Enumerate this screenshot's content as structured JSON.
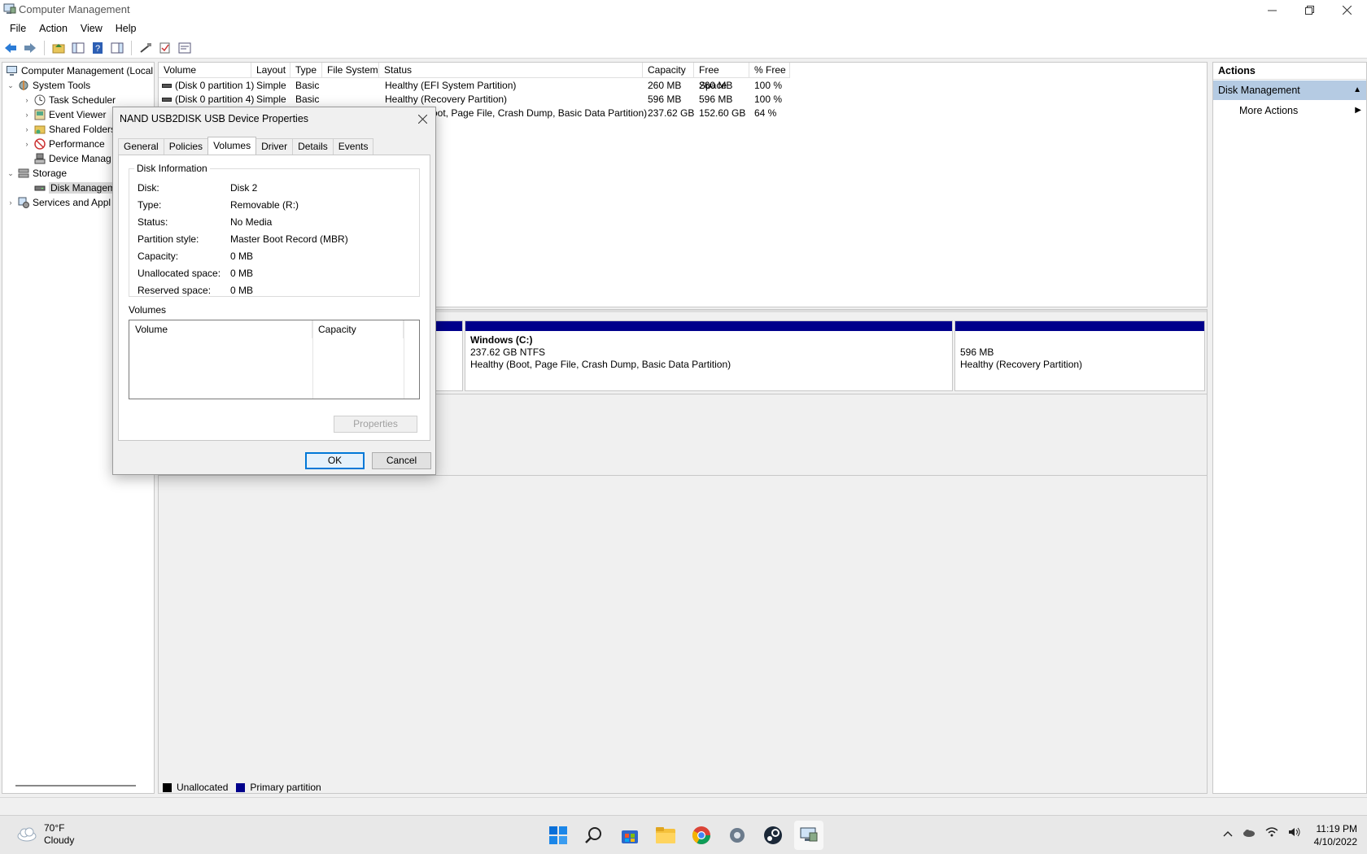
{
  "window": {
    "title": "Computer Management"
  },
  "menu": [
    "File",
    "Action",
    "View",
    "Help"
  ],
  "tree": {
    "root": "Computer Management (Local",
    "items": [
      {
        "label": "System Tools",
        "expander": "⌄"
      },
      {
        "label": "Task Scheduler",
        "expander": "›"
      },
      {
        "label": "Event Viewer",
        "expander": "›"
      },
      {
        "label": "Shared Folders",
        "expander": "›"
      },
      {
        "label": "Performance",
        "expander": "›"
      },
      {
        "label": "Device Manag",
        "expander": ""
      },
      {
        "label": "Storage",
        "expander": "⌄"
      },
      {
        "label": "Disk Managem",
        "expander": ""
      },
      {
        "label": "Services and Appl",
        "expander": "›"
      }
    ]
  },
  "volumes": {
    "columns": [
      "Volume",
      "Layout",
      "Type",
      "File System",
      "Status",
      "Capacity",
      "Free Space",
      "% Free"
    ],
    "rows": [
      {
        "volume": "(Disk 0 partition 1)",
        "layout": "Simple",
        "type": "Basic",
        "fs": "",
        "status": "Healthy (EFI System Partition)",
        "capacity": "260 MB",
        "free": "260 MB",
        "pct": "100 %"
      },
      {
        "volume": "(Disk 0 partition 4)",
        "layout": "Simple",
        "type": "Basic",
        "fs": "",
        "status": "Healthy (Recovery Partition)",
        "capacity": "596 MB",
        "free": "596 MB",
        "pct": "100 %"
      },
      {
        "volume": "",
        "layout": "",
        "type": "",
        "fs": "",
        "status": "oot, Page File, Crash Dump, Basic Data Partition)",
        "capacity": "237.62 GB",
        "free": "152.60 GB",
        "pct": "64 %"
      }
    ]
  },
  "disk_map": {
    "windows": {
      "name": "Windows  (C:)",
      "size": "237.62 GB NTFS",
      "status": "Healthy (Boot, Page File, Crash Dump, Basic Data Partition)"
    },
    "recovery": {
      "size": "596 MB",
      "status": "Healthy (Recovery Partition)"
    }
  },
  "legend": [
    {
      "label": "Unallocated",
      "color": "#000000"
    },
    {
      "label": "Primary partition",
      "color": "#00008b"
    }
  ],
  "actions": {
    "header": "Actions",
    "section": "Disk Management",
    "more": "More Actions"
  },
  "dialog": {
    "title": "NAND USB2DISK USB Device Properties",
    "tabs": [
      "General",
      "Policies",
      "Volumes",
      "Driver",
      "Details",
      "Events"
    ],
    "active_tab": "Volumes",
    "disk_info_title": "Disk Information",
    "info": [
      {
        "key": "Disk:",
        "value": "Disk 2"
      },
      {
        "key": "Type:",
        "value": "Removable (R:)"
      },
      {
        "key": "Status:",
        "value": "No Media"
      },
      {
        "key": "Partition style:",
        "value": "Master Boot Record (MBR)"
      },
      {
        "key": "Capacity:",
        "value": "0 MB"
      },
      {
        "key": "Unallocated space:",
        "value": "0 MB"
      },
      {
        "key": "Reserved space:",
        "value": "0 MB"
      }
    ],
    "volumes_title": "Volumes",
    "volumes_columns": [
      "Volume",
      "Capacity"
    ],
    "properties_label": "Properties",
    "ok_label": "OK",
    "cancel_label": "Cancel"
  },
  "taskbar": {
    "temperature": "70°F",
    "weather": "Cloudy",
    "time": "11:19 PM",
    "date": "4/10/2022"
  },
  "colors": {
    "primary_partition": "#00008b",
    "selection": "#b5cbe3",
    "accent": "#0078d7"
  }
}
